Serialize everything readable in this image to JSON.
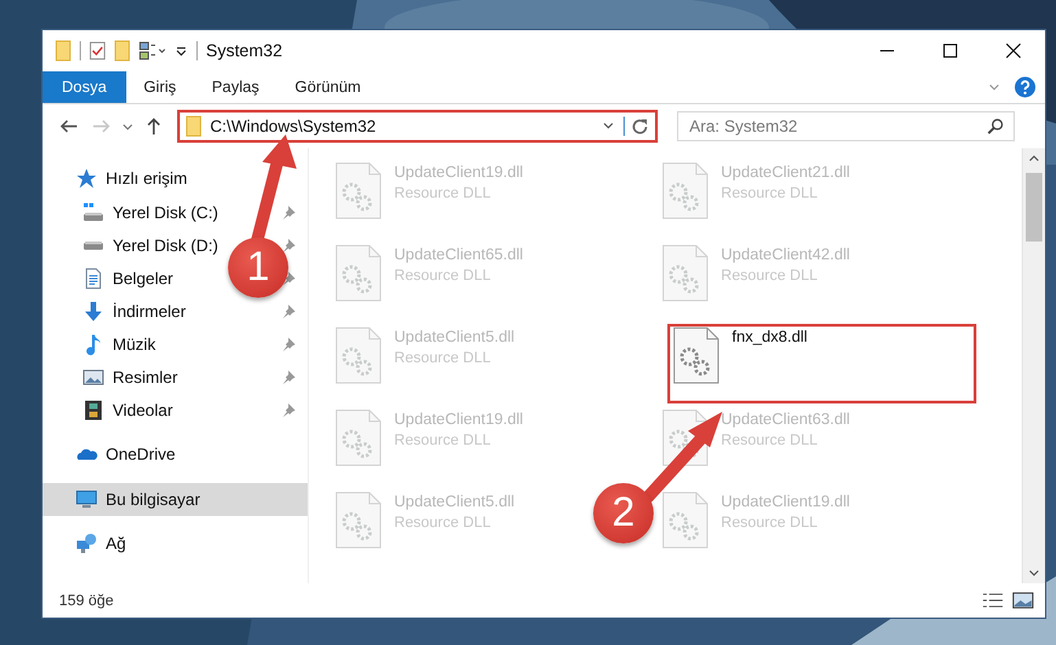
{
  "window": {
    "title": "System32"
  },
  "ribbon_tabs": [
    {
      "label": "Dosya",
      "selected": true
    },
    {
      "label": "Giriş",
      "selected": false
    },
    {
      "label": "Paylaş",
      "selected": false
    },
    {
      "label": "Görünüm",
      "selected": false
    }
  ],
  "address": {
    "value": "C:\\Windows\\System32"
  },
  "search": {
    "placeholder": "Ara: System32"
  },
  "sidebar": {
    "items": [
      {
        "label": "Hızlı erişim",
        "kind": "star",
        "selected": false,
        "children": [
          {
            "label": "Yerel Disk (C:)",
            "kind": "system-drive",
            "pinned": true,
            "selected": false
          },
          {
            "label": "Yerel Disk (D:)",
            "kind": "drive",
            "pinned": true,
            "selected": false
          },
          {
            "label": "Belgeler",
            "kind": "documents",
            "pinned": true,
            "selected": false
          },
          {
            "label": "İndirmeler",
            "kind": "downloads",
            "pinned": true,
            "selected": false
          },
          {
            "label": "Müzik",
            "kind": "music",
            "pinned": true,
            "selected": false
          },
          {
            "label": "Resimler",
            "kind": "pictures",
            "pinned": true,
            "selected": false
          },
          {
            "label": "Videolar",
            "kind": "videos",
            "pinned": true,
            "selected": false
          }
        ]
      },
      {
        "label": "OneDrive",
        "kind": "cloud",
        "selected": false
      },
      {
        "label": "Bu bilgisayar",
        "kind": "computer",
        "selected": true
      },
      {
        "label": "Ağ",
        "kind": "network",
        "selected": false
      }
    ]
  },
  "files": [
    {
      "name": "UpdateClient19.dll",
      "type": "Resource DLL",
      "kind": "blurred"
    },
    {
      "name": "UpdateClient21.dll",
      "type": "Resource DLL",
      "kind": "blurred"
    },
    {
      "name": "UpdateClient65.dll",
      "type": "Resource DLL",
      "kind": "blurred"
    },
    {
      "name": "UpdateClient42.dll",
      "type": "Resource DLL",
      "kind": "blurred"
    },
    {
      "name": "UpdateClient5.dll",
      "type": "Resource DLL",
      "kind": "blurred"
    },
    {
      "name": "fnx_dx8.dll",
      "kind": "plain"
    },
    {
      "name": "UpdateClient19.dll",
      "type": "Resource DLL",
      "kind": "blurred"
    },
    {
      "name": "UpdateClient63.dll",
      "type": "Resource DLL",
      "kind": "blurred"
    },
    {
      "name": "UpdateClient5.dll",
      "type": "Resource DLL",
      "kind": "blurred"
    },
    {
      "name": "UpdateClient19.dll",
      "type": "Resource DLL",
      "kind": "blurred"
    }
  ],
  "status_bar": {
    "count": "159 öğe"
  },
  "annotations": [
    {
      "label": "1"
    },
    {
      "label": "2"
    }
  ]
}
